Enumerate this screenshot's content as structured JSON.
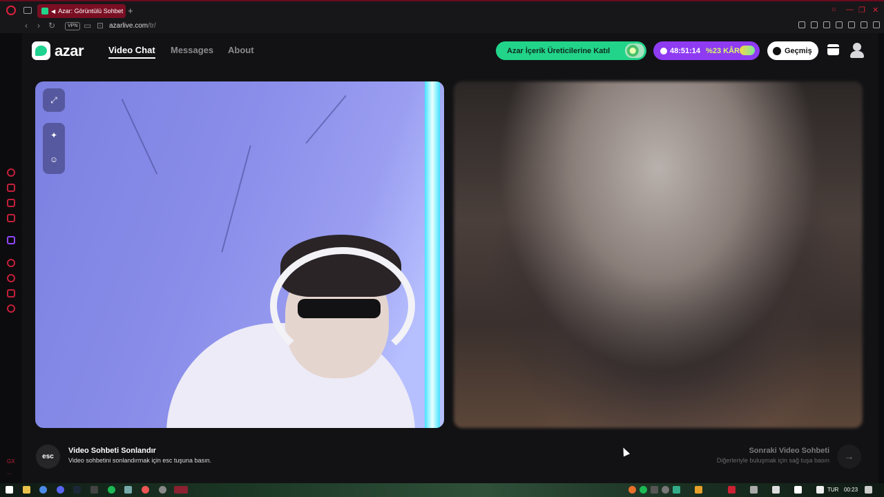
{
  "browser": {
    "tab_title": "Azar: Görüntülü Sohbet",
    "new_tab_label": "+",
    "vpn_label": "VPN",
    "url_host": "azarlive.com",
    "url_path": "/tr/"
  },
  "header": {
    "logo_text": "azar",
    "nav": [
      {
        "label": "Video Chat",
        "active": true
      },
      {
        "label": "Messages",
        "active": false
      },
      {
        "label": "About",
        "active": false
      }
    ],
    "creator_button": "Azar İçerik Üreticilerine Katıl",
    "timer": "48:51:14",
    "discount": "%23 KÂR",
    "history_button": "Geçmiş"
  },
  "footer": {
    "esc_key": "esc",
    "end_title": "Video Sohbeti Sonlandır",
    "end_subtitle": "Video sohbetini sonlandırmak için esc tuşuna basın.",
    "next_title": "Sonraki Video Sohbeti",
    "next_subtitle": "Diğerleriyle buluşmak için sağ tuşa basın",
    "next_arrow": "→"
  },
  "sidebar": {
    "bottom_label": "GX"
  },
  "taskbar": {
    "language": "TUR",
    "time": "00:23"
  },
  "colors": {
    "brand_green": "#22d48a",
    "promo_purple": "#8e3bf2",
    "browser_accent": "#c41f3a"
  }
}
